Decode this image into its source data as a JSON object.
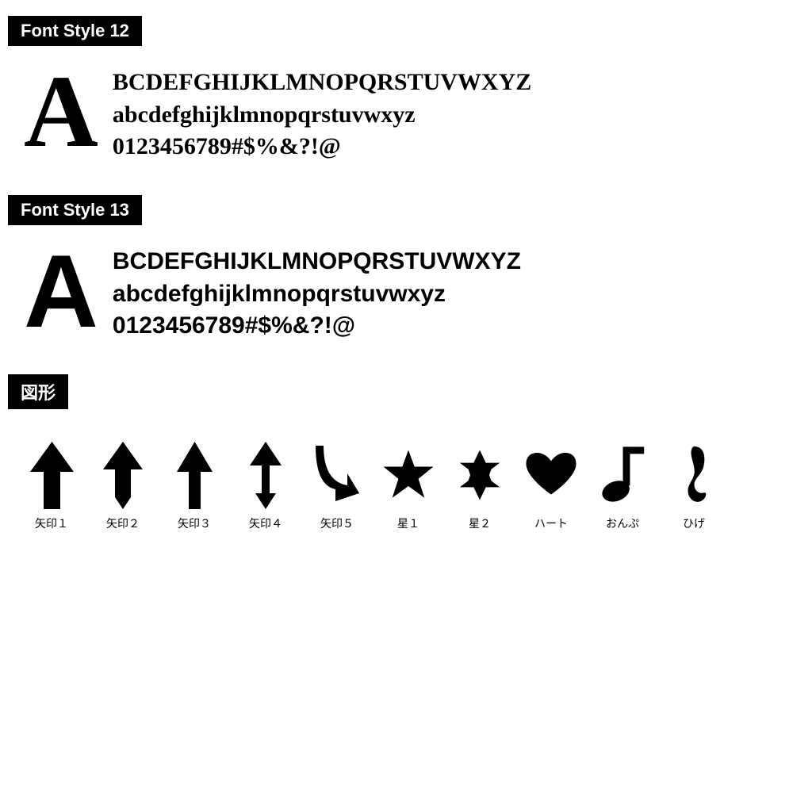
{
  "font_style_12": {
    "label": "Font Style 12",
    "big_letter": "A",
    "lines": [
      "BCDEFGHIJKLMNOPQRSTUVWXYZ",
      "abcdefghijklmnopqrstuvwxyz",
      "0123456789#$%&?!@"
    ]
  },
  "font_style_13": {
    "label": "Font Style 13",
    "big_letter": "A",
    "lines": [
      "BCDEFGHIJKLMNOPQRSTUVWXYZ",
      "abcdefghijklmnopqrstuvwxyz",
      "0123456789#$%&?!@"
    ]
  },
  "shapes_section": {
    "label": "図形",
    "shapes": [
      {
        "id": "yajirushi1",
        "caption": "矢印１"
      },
      {
        "id": "yajirushi2",
        "caption": "矢印２"
      },
      {
        "id": "yajirushi3",
        "caption": "矢印３"
      },
      {
        "id": "yajirushi4",
        "caption": "矢印４"
      },
      {
        "id": "yajirushi5",
        "caption": "矢印５"
      },
      {
        "id": "hoshi1",
        "caption": "星１"
      },
      {
        "id": "hoshi2",
        "caption": "星２"
      },
      {
        "id": "heart",
        "caption": "ハート"
      },
      {
        "id": "onpu",
        "caption": "おんぷ"
      },
      {
        "id": "hige",
        "caption": "ひげ"
      }
    ]
  }
}
